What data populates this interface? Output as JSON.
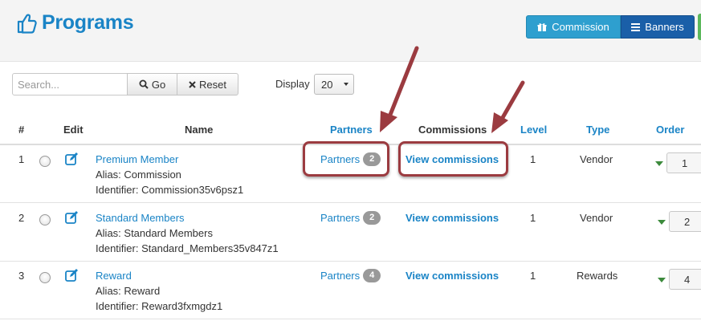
{
  "header": {
    "title": "Programs",
    "title_icon": "thumbs-up-icon",
    "buttons": [
      {
        "label": "Commission",
        "icon": "gift-icon"
      },
      {
        "label": "Banners",
        "icon": "list-icon"
      }
    ]
  },
  "filters": {
    "search_placeholder": "Search...",
    "search_value": "",
    "go_label": "Go",
    "reset_label": "Reset",
    "display_label": "Display",
    "display_value": "20"
  },
  "table": {
    "columns": {
      "num": "#",
      "edit": "Edit",
      "name": "Name",
      "partners": "Partners",
      "commissions": "Commissions",
      "level": "Level",
      "type": "Type",
      "order": "Order"
    },
    "rows": [
      {
        "num": "1",
        "name": "Premium Member",
        "alias": "Alias: Commission",
        "identifier": "Identifier: Commission35v6psz1",
        "partners_label": "Partners",
        "partners_count": "2",
        "commissions_label": "View commissions",
        "level": "1",
        "type": "Vendor",
        "order": "1"
      },
      {
        "num": "2",
        "name": "Standard Members",
        "alias": "Alias: Standard Members",
        "identifier": "Identifier: Standard_Members35v847z1",
        "partners_label": "Partners",
        "partners_count": "2",
        "commissions_label": "View commissions",
        "level": "1",
        "type": "Vendor",
        "order": "2"
      },
      {
        "num": "3",
        "name": "Reward",
        "alias": "Alias: Reward",
        "identifier": "Identifier: Reward3fxmgdz1",
        "partners_label": "Partners",
        "partners_count": "4",
        "commissions_label": "View commissions",
        "level": "1",
        "type": "Rewards",
        "order": "4"
      }
    ]
  },
  "colors": {
    "link": "#1a84c6",
    "commission_button": "#2e9fcf",
    "banners_button": "#1a5fa8",
    "annotation": "#9b3b40",
    "badge": "#999999",
    "order_arrow": "#3c8a3c"
  }
}
